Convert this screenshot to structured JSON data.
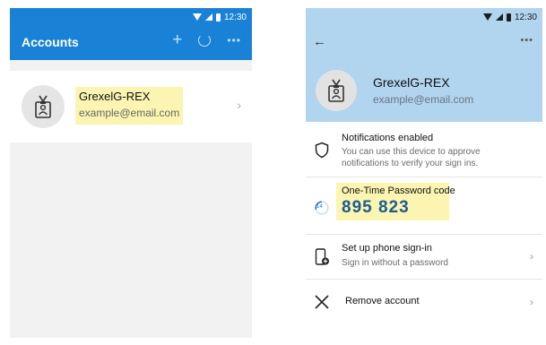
{
  "status_bar": {
    "time": "12:30"
  },
  "left": {
    "title": "Accounts",
    "header_icons": {
      "add": "+",
      "more": "•••"
    },
    "account": {
      "name": "GrexelG-REX",
      "email": "example@email.com",
      "chevron": "›"
    }
  },
  "right": {
    "back": "←",
    "more": "•••",
    "account": {
      "name": "GrexelG-REX",
      "email": "example@email.com"
    },
    "notifications": {
      "title": "Notifications enabled",
      "subtitle": "You can use this device to approve notifications to verify your sign ins."
    },
    "otp": {
      "label": "One-Time Password code",
      "timer": "14",
      "code": "895 823"
    },
    "phone_signin": {
      "title": "Set up phone sign-in",
      "subtitle": "Sign in without a password",
      "chevron": "›"
    },
    "remove": {
      "title": "Remove account",
      "chevron": "›"
    }
  },
  "colors": {
    "left_header": "#1a82d6",
    "right_header": "#b1d4ef",
    "highlight": "#fbf5b1",
    "otp_code": "#1c5c91"
  }
}
